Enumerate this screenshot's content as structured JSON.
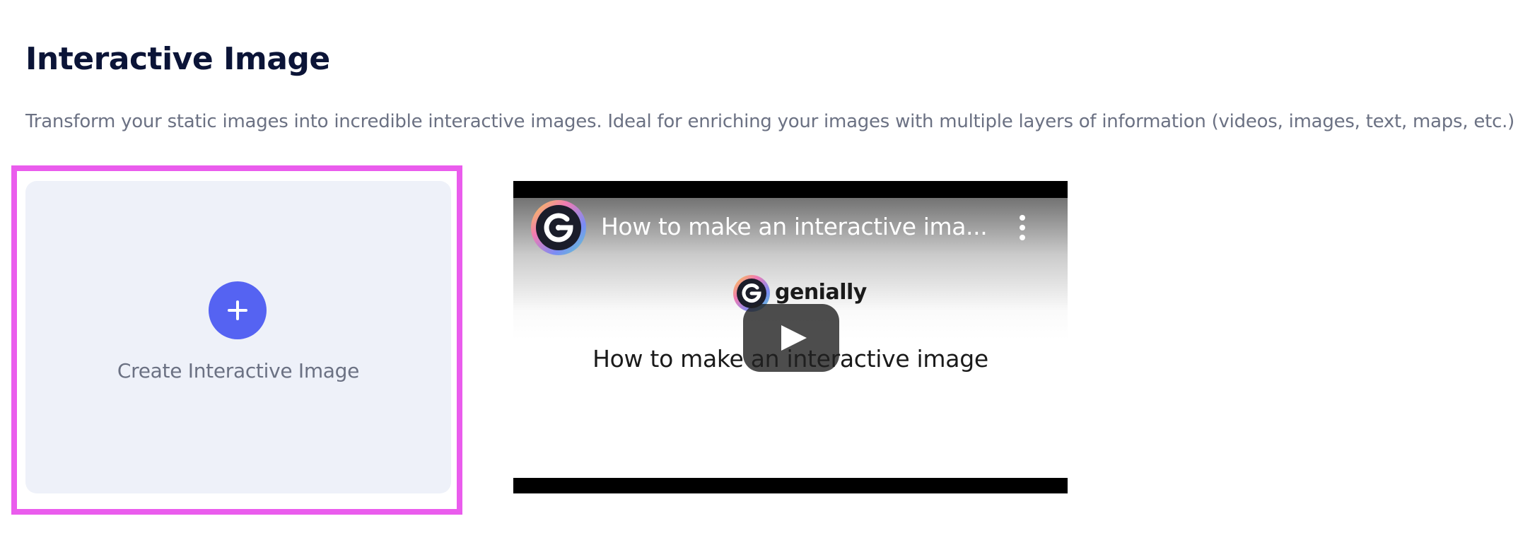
{
  "page": {
    "title": "Interactive Image",
    "description": "Transform your static images into incredible interactive images. Ideal for enriching your images with multiple layers of information (videos, images, text, maps, etc.)"
  },
  "create_card": {
    "label": "Create Interactive Image",
    "icon": "plus-icon",
    "highlight_color": "#ea5ced",
    "accent_color": "#5563f2"
  },
  "video": {
    "title": "How to make an interactive ima...",
    "brand": "genially",
    "slide_title": "How to make an interactive image",
    "icons": [
      "channel-avatar-icon",
      "more-options-icon",
      "play-icon"
    ]
  }
}
